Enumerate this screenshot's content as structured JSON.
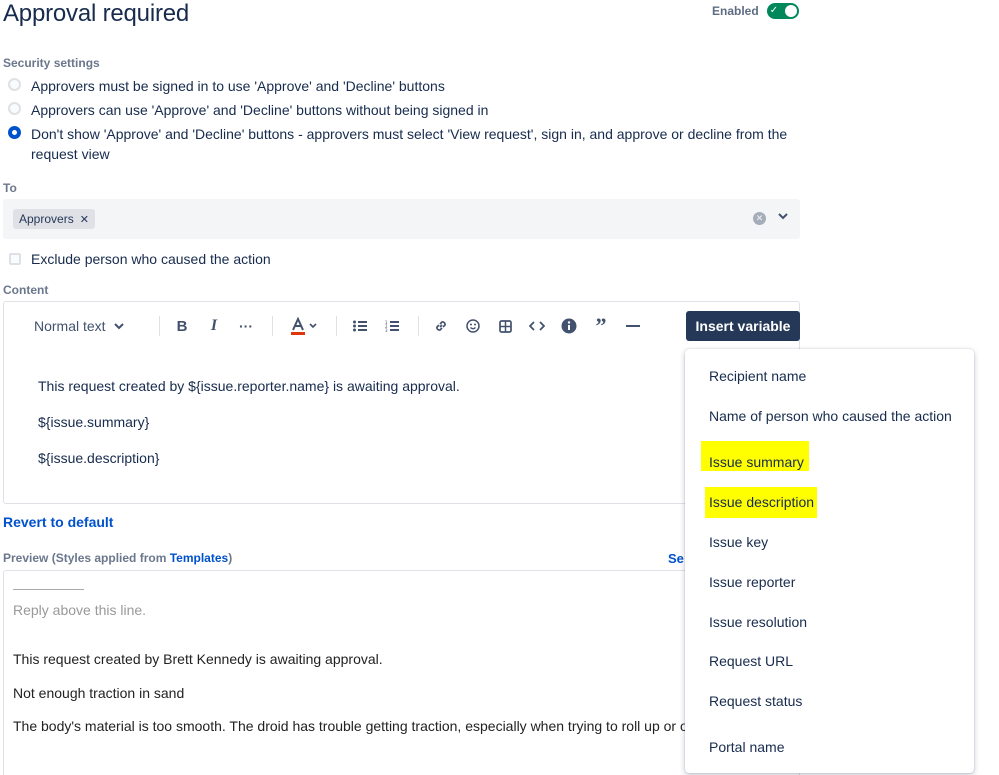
{
  "header": {
    "title": "Approval required",
    "enabled_label": "Enabled"
  },
  "security": {
    "label": "Security settings",
    "options": [
      {
        "label": "Approvers must be signed in to use 'Approve' and 'Decline' buttons",
        "checked": false
      },
      {
        "label": "Approvers can use 'Approve' and 'Decline' buttons without being signed in",
        "checked": false
      },
      {
        "label": "Don't show 'Approve' and 'Decline' buttons - approvers must select 'View request', sign in, and approve or decline from the request view",
        "checked": true
      }
    ]
  },
  "to": {
    "label": "To",
    "tags": [
      "Approvers"
    ]
  },
  "exclude": {
    "label": "Exclude person who caused the action",
    "checked": false
  },
  "content": {
    "label": "Content",
    "toolbar": {
      "text_style": "Normal text",
      "insert_variable": "Insert variable"
    },
    "lines": [
      "This request created by ${issue.reporter.name} is awaiting approval.",
      "${issue.summary}",
      "${issue.description}"
    ]
  },
  "revert": "Revert to default",
  "preview": {
    "label_prefix": "Preview (Styles applied from ",
    "label_link": "Templates",
    "label_suffix": ")",
    "send_link": "Se",
    "divider": "____________",
    "reply_line": "Reply above this line.",
    "lines": [
      "This request created by Brett Kennedy is awaiting approval.",
      "Not enough traction in sand",
      "The body's material is too smooth. The droid has trouble getting traction, especially when trying to roll up or o"
    ]
  },
  "variables_menu": {
    "items": [
      "Recipient name",
      "Name of person who caused the action",
      "Issue summary",
      "Issue description",
      "Issue key",
      "Issue reporter",
      "Issue resolution",
      "Request URL",
      "Request status",
      "Portal name"
    ],
    "highlighted": [
      "Issue summary",
      "Issue description"
    ],
    "highlight_color": "#ffff00"
  },
  "colors": {
    "toggle_on": "#00875a",
    "radio_checked": "#0052cc",
    "insert_button": "#253858",
    "link": "#0052cc"
  }
}
